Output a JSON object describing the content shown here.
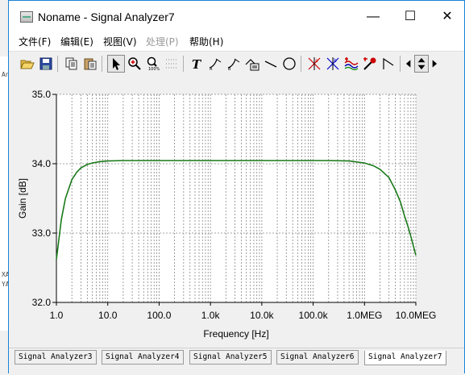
{
  "window": {
    "title": "Noname - Signal Analyzer7",
    "controls": {
      "minimize": "—",
      "maximize": "☐",
      "close": "✕"
    }
  },
  "background_window_text": [
    "Ana",
    "XA",
    "YA"
  ],
  "menu": [
    {
      "label": "文件(F)",
      "enabled": true
    },
    {
      "label": "编辑(E)",
      "enabled": true
    },
    {
      "label": "视图(V)",
      "enabled": true
    },
    {
      "label": "处理(P)",
      "enabled": false
    },
    {
      "label": "帮助(H)",
      "enabled": true
    }
  ],
  "toolbar_icons": [
    "open-icon",
    "save-icon",
    "copy-icon",
    "paste-icon",
    "pointer-icon",
    "zoom-in-icon",
    "zoom-100-icon",
    "grid-icon",
    "text-icon",
    "cursor-a-icon",
    "cursor-b-icon",
    "label-icon",
    "line-icon",
    "circle-icon",
    "marker-a-icon",
    "marker-b-icon",
    "waves-icon",
    "probe-icon",
    "step-icon",
    "arrow-left-icon",
    "arrow-updown-icon",
    "arrow-right-icon"
  ],
  "colors": {
    "curve": "#1a7a1a",
    "grid": "#888888",
    "plot_bg": "#ffffff"
  },
  "chart_data": {
    "type": "line",
    "xlabel": "Frequency [Hz]",
    "ylabel": "Gain [dB]",
    "xscale": "log",
    "xlim": [
      1,
      10000000
    ],
    "ylim": [
      32.0,
      35.0
    ],
    "x_tick_labels": [
      "1.0",
      "10.0",
      "100.0",
      "1.0k",
      "10.0k",
      "100.0k",
      "1.0MEG",
      "10.0MEG"
    ],
    "y_tick_labels": [
      "32.0",
      "33.0",
      "34.0",
      "35.0"
    ],
    "y_ticks": [
      32.0,
      33.0,
      34.0,
      35.0
    ],
    "grid": true,
    "series": [
      {
        "x": [
          1,
          1.25,
          1.5,
          2,
          2.5,
          3,
          4,
          5,
          7,
          10,
          20,
          50,
          100,
          1000,
          10000,
          100000,
          200000,
          500000,
          1000000,
          1500000,
          2000000,
          3000000,
          4000000,
          5000000,
          6000000,
          7000000,
          8000000,
          10000000
        ],
        "y": [
          32.62,
          33.2,
          33.5,
          33.77,
          33.88,
          33.94,
          33.99,
          34.01,
          34.03,
          34.04,
          34.045,
          34.045,
          34.045,
          34.045,
          34.045,
          34.045,
          34.045,
          34.04,
          34.01,
          33.97,
          33.92,
          33.8,
          33.62,
          33.45,
          33.25,
          33.1,
          32.95,
          32.68
        ]
      }
    ]
  },
  "tabs": [
    {
      "label": "Signal Analyzer3",
      "active": false
    },
    {
      "label": "Signal Analyzer4",
      "active": false
    },
    {
      "label": "Signal Analyzer5",
      "active": false
    },
    {
      "label": "Signal Analyzer6",
      "active": false
    },
    {
      "label": "Signal Analyzer7",
      "active": true
    }
  ]
}
